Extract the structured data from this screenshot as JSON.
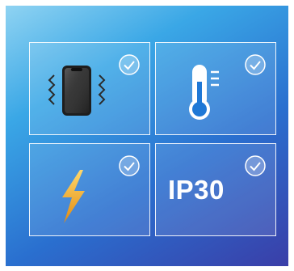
{
  "features": [
    {
      "icon": "vibrating-phone-icon",
      "checked": true
    },
    {
      "icon": "thermometer-icon",
      "checked": true
    },
    {
      "icon": "lightning-bolt-icon",
      "checked": true
    },
    {
      "icon": "check-icon",
      "label": "IP30",
      "checked": true
    }
  ],
  "colors": {
    "panel_top": "#8fd3f2",
    "panel_bottom": "#3a3ea8",
    "bolt": "#f2a81d",
    "thermo_blue": "#1f78d6"
  }
}
